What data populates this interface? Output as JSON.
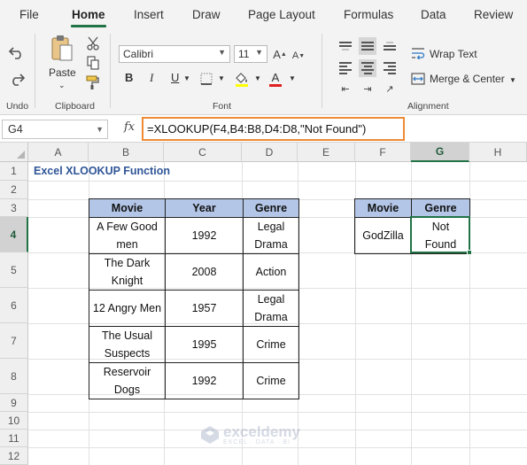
{
  "menu": {
    "items": [
      "File",
      "Home",
      "Insert",
      "Draw",
      "Page Layout",
      "Formulas",
      "Data",
      "Review"
    ],
    "active": "Home"
  },
  "ribbon": {
    "undo_group_label": "Undo",
    "clipboard": {
      "paste_label": "Paste",
      "group_label": "Clipboard"
    },
    "font": {
      "family": "Calibri",
      "size": "11",
      "group_label": "Font",
      "bold": "B",
      "italic": "I",
      "underline": "U"
    },
    "alignment": {
      "wrap_text": "Wrap Text",
      "merge_center": "Merge & Center",
      "group_label": "Alignment"
    }
  },
  "formula_bar": {
    "name_box": "G4",
    "fx": "fx",
    "formula": "=XLOOKUP(F4,B4:B8,D4:D8,\"Not Found\")"
  },
  "sheet": {
    "columns": [
      "A",
      "B",
      "C",
      "D",
      "E",
      "F",
      "G",
      "H"
    ],
    "selected_column": "G",
    "rows": [
      "1",
      "2",
      "3",
      "4",
      "5",
      "6",
      "7",
      "8",
      "9",
      "10",
      "11",
      "12"
    ],
    "selected_row": "4",
    "title": "Excel XLOOKUP Function",
    "main_table": {
      "headers": [
        "Movie",
        "Year",
        "Genre"
      ],
      "rows": [
        [
          "A Few Good men",
          "1992",
          "Legal Drama"
        ],
        [
          "The Dark Knight",
          "2008",
          "Action"
        ],
        [
          "12 Angry Men",
          "1957",
          "Legal Drama"
        ],
        [
          "The Usual Suspects",
          "1995",
          "Crime"
        ],
        [
          "Reservoir Dogs",
          "1992",
          "Crime"
        ]
      ]
    },
    "lookup_table": {
      "headers": [
        "Movie",
        "Genre"
      ],
      "movie": "GodZilla",
      "result": "Not Found"
    }
  },
  "watermark": {
    "name": "exceldemy",
    "tagline": "EXCEL · DATA · BI"
  },
  "colors": {
    "accent": "#217346",
    "header_fill": "#b4c6e7",
    "title": "#2f5597",
    "formula_highlight": "#ee8a34"
  }
}
